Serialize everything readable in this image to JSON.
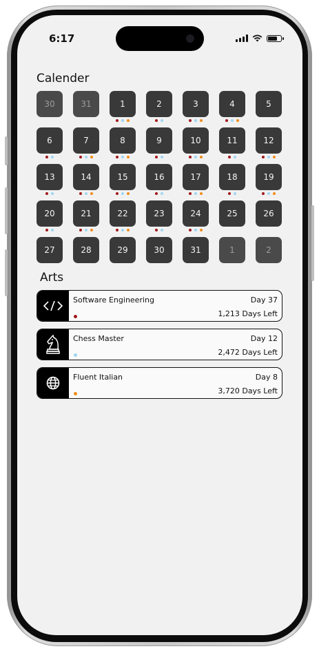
{
  "status": {
    "time": "6:17"
  },
  "calendar": {
    "title": "Calender",
    "colors": {
      "red": "#a0161c",
      "blue": "#9ed6f2",
      "orange": "#f08c1a"
    },
    "days": [
      {
        "label": "30",
        "muted": true,
        "dots": []
      },
      {
        "label": "31",
        "muted": true,
        "dots": []
      },
      {
        "label": "1",
        "muted": false,
        "dots": [
          "red",
          "blue",
          "orange"
        ]
      },
      {
        "label": "2",
        "muted": false,
        "dots": [
          "red",
          "blue"
        ]
      },
      {
        "label": "3",
        "muted": false,
        "dots": [
          "red",
          "blue",
          "orange"
        ]
      },
      {
        "label": "4",
        "muted": false,
        "dots": [
          "red",
          "blue",
          "orange"
        ]
      },
      {
        "label": "5",
        "muted": false,
        "dots": []
      },
      {
        "label": "6",
        "muted": false,
        "dots": [
          "red",
          "blue"
        ]
      },
      {
        "label": "7",
        "muted": false,
        "dots": [
          "red",
          "blue",
          "orange"
        ]
      },
      {
        "label": "8",
        "muted": false,
        "dots": [
          "red",
          "blue",
          "orange"
        ]
      },
      {
        "label": "9",
        "muted": false,
        "dots": [
          "red",
          "blue"
        ]
      },
      {
        "label": "10",
        "muted": false,
        "dots": [
          "red",
          "blue",
          "orange"
        ]
      },
      {
        "label": "11",
        "muted": false,
        "dots": [
          "red",
          "blue"
        ]
      },
      {
        "label": "12",
        "muted": false,
        "dots": [
          "red",
          "blue",
          "orange"
        ]
      },
      {
        "label": "13",
        "muted": false,
        "dots": [
          "red",
          "blue"
        ]
      },
      {
        "label": "14",
        "muted": false,
        "dots": [
          "red",
          "blue",
          "orange"
        ]
      },
      {
        "label": "15",
        "muted": false,
        "dots": [
          "red",
          "blue",
          "orange"
        ]
      },
      {
        "label": "16",
        "muted": false,
        "dots": [
          "red",
          "blue"
        ]
      },
      {
        "label": "17",
        "muted": false,
        "dots": [
          "red",
          "blue",
          "orange"
        ]
      },
      {
        "label": "18",
        "muted": false,
        "dots": [
          "red",
          "blue"
        ]
      },
      {
        "label": "19",
        "muted": false,
        "dots": [
          "red",
          "blue",
          "orange"
        ]
      },
      {
        "label": "20",
        "muted": false,
        "dots": [
          "red",
          "blue"
        ]
      },
      {
        "label": "21",
        "muted": false,
        "dots": [
          "red",
          "blue",
          "orange"
        ]
      },
      {
        "label": "22",
        "muted": false,
        "dots": [
          "red",
          "blue",
          "orange"
        ]
      },
      {
        "label": "23",
        "muted": false,
        "dots": [
          "red",
          "blue"
        ]
      },
      {
        "label": "24",
        "muted": false,
        "dots": [
          "red",
          "blue",
          "orange"
        ]
      },
      {
        "label": "25",
        "muted": false,
        "dots": []
      },
      {
        "label": "26",
        "muted": false,
        "dots": []
      },
      {
        "label": "27",
        "muted": false,
        "dots": []
      },
      {
        "label": "28",
        "muted": false,
        "dots": []
      },
      {
        "label": "29",
        "muted": false,
        "dots": []
      },
      {
        "label": "30",
        "muted": false,
        "dots": []
      },
      {
        "label": "31",
        "muted": false,
        "dots": []
      },
      {
        "label": "1",
        "muted": true,
        "dots": []
      },
      {
        "label": "2",
        "muted": true,
        "dots": []
      }
    ]
  },
  "arts": {
    "title": "Arts",
    "items": [
      {
        "name": "Software Engineering",
        "day": "Day 37",
        "days_left": "1,213 Days Left",
        "icon": "code-icon",
        "dot_color": "#a0161c"
      },
      {
        "name": "Chess Master",
        "day": "Day 12",
        "days_left": "2,472 Days Left",
        "icon": "chess-knight-icon",
        "dot_color": "#9ed6f2"
      },
      {
        "name": "Fluent Italian",
        "day": "Day 8",
        "days_left": "3,720 Days Left",
        "icon": "globe-icon",
        "dot_color": "#f08c1a"
      }
    ]
  }
}
